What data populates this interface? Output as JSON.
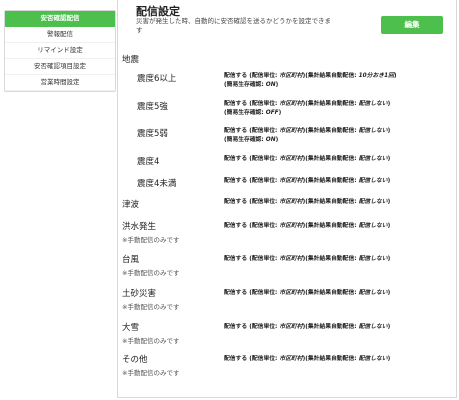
{
  "sidebar": {
    "items": [
      {
        "label": "安否確認配信",
        "active": true
      },
      {
        "label": "警報配信",
        "active": false
      },
      {
        "label": "リマインド設定",
        "active": false
      },
      {
        "label": "安否確認項目設定",
        "active": false
      },
      {
        "label": "営業時間設定",
        "active": false
      }
    ]
  },
  "header": {
    "title": "配信設定",
    "description": "災害が発生した時、自動的に安否確認を送るかどうかを設定できます",
    "edit_label": "編集"
  },
  "earthquake": {
    "section_title": "地震"
  },
  "rows": [
    {
      "name": "震度6以上",
      "line1_pre": "配信する (配信単位: ",
      "unit": "市区町村",
      "line1_mid": ")(集計結果自動配信: ",
      "line1_val": "10分おき1回",
      "line1_post": ")",
      "line2_pre": "(簡易生存確認: ",
      "line2_val": "ON",
      "line2_post": ")"
    },
    {
      "name": "震度5強",
      "line1_pre": "配信する (配信単位: ",
      "unit": "市区町村",
      "line1_mid": ")(集計結果自動配信: ",
      "line1_val": "配信しない",
      "line1_post": ")",
      "line2_pre": "(簡易生存確認: ",
      "line2_val": "OFF",
      "line2_post": ")"
    },
    {
      "name": "震度5弱",
      "line1_pre": "配信する (配信単位: ",
      "unit": "市区町村",
      "line1_mid": ")(集計結果自動配信: ",
      "line1_val": "配信しない",
      "line1_post": ")",
      "line2_pre": "(簡易生存確認: ",
      "line2_val": "ON",
      "line2_post": ")"
    },
    {
      "name": "震度4",
      "line1_pre": "配信する (配信単位: ",
      "unit": "市区町村",
      "line1_mid": ")(集計結果自動配信: ",
      "line1_val": "配信しない",
      "line1_post": ")"
    },
    {
      "name": "震度4未満",
      "line1_pre": "配信する (配信単位: ",
      "unit": "市区町村",
      "line1_mid": ")(集計結果自動配信: ",
      "line1_val": "配信しない",
      "line1_post": ")"
    },
    {
      "name": "津波",
      "line1_pre": "配信する (配信単位: ",
      "unit": "市区町村",
      "line1_mid": ")(集計結果自動配信: ",
      "line1_val": "配信しない",
      "line1_post": ")"
    },
    {
      "name": "洪水発生",
      "note": "※手動配信のみです",
      "line1_pre": "配信する (配信単位: ",
      "unit": "市区町村",
      "line1_mid": ")(集計結果自動配信: ",
      "line1_val": "配信しない",
      "line1_post": ")"
    },
    {
      "name": "台風",
      "note": "※手動配信のみです",
      "line1_pre": "配信する (配信単位: ",
      "unit": "市区町村",
      "line1_mid": ")(集計結果自動配信: ",
      "line1_val": "配信しない",
      "line1_post": ")"
    },
    {
      "name": "土砂災害",
      "note": "※手動配信のみです",
      "line1_pre": "配信する (配信単位: ",
      "unit": "市区町村",
      "line1_mid": ")(集計結果自動配信: ",
      "line1_val": "配信しない",
      "line1_post": ")"
    },
    {
      "name": "大雪",
      "note": "※手動配信のみです",
      "line1_pre": "配信する (配信単位: ",
      "unit": "市区町村",
      "line1_mid": ")(集計結果自動配信: ",
      "line1_val": "配信しない",
      "line1_post": ")"
    },
    {
      "name": "その他",
      "note": "※手動配信のみです",
      "line1_pre": "配信する (配信単位: ",
      "unit": "市区町村",
      "line1_mid": ")(集計結果自動配信: ",
      "line1_val": "配信しない",
      "line1_post": ")"
    }
  ],
  "colors": {
    "accent": "#4cbf4c",
    "border": "#d8d8d8"
  }
}
